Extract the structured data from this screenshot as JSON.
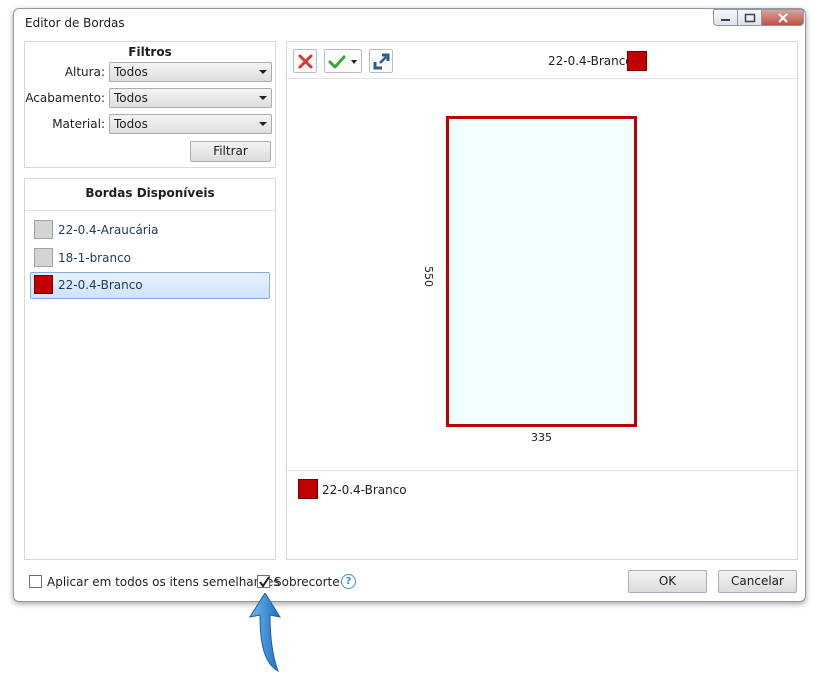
{
  "window": {
    "title": "Editor de Bordas"
  },
  "filters": {
    "header": "Filtros",
    "rows": [
      {
        "label": "Altura:",
        "value": "Todos"
      },
      {
        "label": "Acabamento:",
        "value": "Todos"
      },
      {
        "label": "Material:",
        "value": "Todos"
      }
    ],
    "filter_button": "Filtrar"
  },
  "available": {
    "header": "Bordas Disponíveis",
    "items": [
      {
        "name": "22-0.4-Araucária",
        "color": "#d4d4d4"
      },
      {
        "name": "18-1-branco",
        "color": "#d4d4d4"
      },
      {
        "name": "22-0.4-Branco",
        "color": "#c00000",
        "selected": true
      }
    ]
  },
  "preview": {
    "current_name": "22-0.4-Branco",
    "current_color": "#c00000",
    "width_label": "335",
    "height_label": "550",
    "legend_name": "22-0.4-Branco"
  },
  "footer": {
    "apply_all_label": "Aplicar em todos os itens semelhantes",
    "apply_all_checked": false,
    "sobrecorte_label": "Sobrecorte",
    "sobrecorte_checked": true,
    "help": "?",
    "ok": "OK",
    "cancel": "Cancelar"
  }
}
